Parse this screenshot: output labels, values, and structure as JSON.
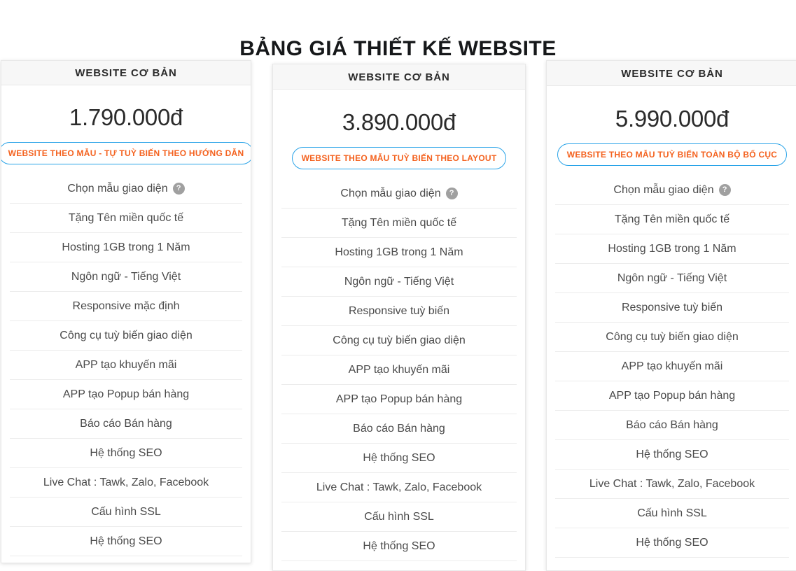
{
  "page": {
    "title": "BẢNG GIÁ THIẾT KẾ WEBSITE"
  },
  "colors": {
    "badge_text": "#f4621f",
    "badge_border": "#29a3e8",
    "card_header_bg": "#f7f7f7",
    "help_icon_bg": "#a0a0a0",
    "title_text": "#16181a"
  },
  "help_icon_glyph": "?",
  "plans": [
    {
      "header": "WEBSITE CƠ BẢN",
      "price": "1.790.000đ",
      "badge": "WEBSITE THEO MẪU - TỰ TUỲ BIẾN THEO HƯỚNG DẪN",
      "features": [
        {
          "label": "Chọn mẫu giao diện",
          "help": true
        },
        {
          "label": "Tặng Tên miền quốc tế",
          "help": false
        },
        {
          "label": "Hosting 1GB trong 1 Năm",
          "help": false
        },
        {
          "label": "Ngôn ngữ - Tiếng Việt",
          "help": false
        },
        {
          "label": "Responsive mặc định",
          "help": false
        },
        {
          "label": "Công cụ tuỳ biến giao diện",
          "help": false
        },
        {
          "label": "APP tạo khuyến mãi",
          "help": false
        },
        {
          "label": "APP tạo Popup bán hàng",
          "help": false
        },
        {
          "label": "Báo cáo Bán hàng",
          "help": false
        },
        {
          "label": "Hệ thống SEO",
          "help": false
        },
        {
          "label": "Live Chat : Tawk, Zalo, Facebook",
          "help": false
        },
        {
          "label": "Cấu hình SSL",
          "help": false
        },
        {
          "label": "Hệ thống SEO",
          "help": false
        }
      ]
    },
    {
      "header": "WEBSITE CƠ BẢN",
      "price": "3.890.000đ",
      "badge": "WEBSITE THEO MẪU TUỲ BIẾN THEO LAYOUT",
      "features": [
        {
          "label": "Chọn mẫu giao diện",
          "help": true
        },
        {
          "label": "Tặng Tên miền quốc tế",
          "help": false
        },
        {
          "label": "Hosting 1GB trong 1 Năm",
          "help": false
        },
        {
          "label": "Ngôn ngữ - Tiếng Việt",
          "help": false
        },
        {
          "label": "Responsive tuỳ biến",
          "help": false
        },
        {
          "label": "Công cụ tuỳ biến giao diện",
          "help": false
        },
        {
          "label": "APP tạo khuyến mãi",
          "help": false
        },
        {
          "label": "APP tạo Popup bán hàng",
          "help": false
        },
        {
          "label": "Báo cáo Bán hàng",
          "help": false
        },
        {
          "label": "Hệ thống SEO",
          "help": false
        },
        {
          "label": "Live Chat : Tawk, Zalo, Facebook",
          "help": false
        },
        {
          "label": "Cấu hình SSL",
          "help": false
        },
        {
          "label": "Hệ thống SEO",
          "help": false
        }
      ]
    },
    {
      "header": "WEBSITE CƠ BẢN",
      "price": "5.990.000đ",
      "badge": "WEBSITE THEO MẪU TUỲ BIẾN TOÀN BỘ BỐ CỤC",
      "features": [
        {
          "label": "Chọn mẫu giao diện",
          "help": true
        },
        {
          "label": "Tặng Tên miền quốc tế",
          "help": false
        },
        {
          "label": "Hosting 1GB trong 1 Năm",
          "help": false
        },
        {
          "label": "Ngôn ngữ - Tiếng Việt",
          "help": false
        },
        {
          "label": "Responsive tuỳ biến",
          "help": false
        },
        {
          "label": "Công cụ tuỳ biến giao diện",
          "help": false
        },
        {
          "label": "APP tạo khuyến mãi",
          "help": false
        },
        {
          "label": "APP tạo Popup bán hàng",
          "help": false
        },
        {
          "label": "Báo cáo Bán hàng",
          "help": false
        },
        {
          "label": "Hệ thống SEO",
          "help": false
        },
        {
          "label": "Live Chat : Tawk, Zalo, Facebook",
          "help": false
        },
        {
          "label": "Cấu hình SSL",
          "help": false
        },
        {
          "label": "Hệ thống SEO",
          "help": false
        }
      ]
    }
  ]
}
